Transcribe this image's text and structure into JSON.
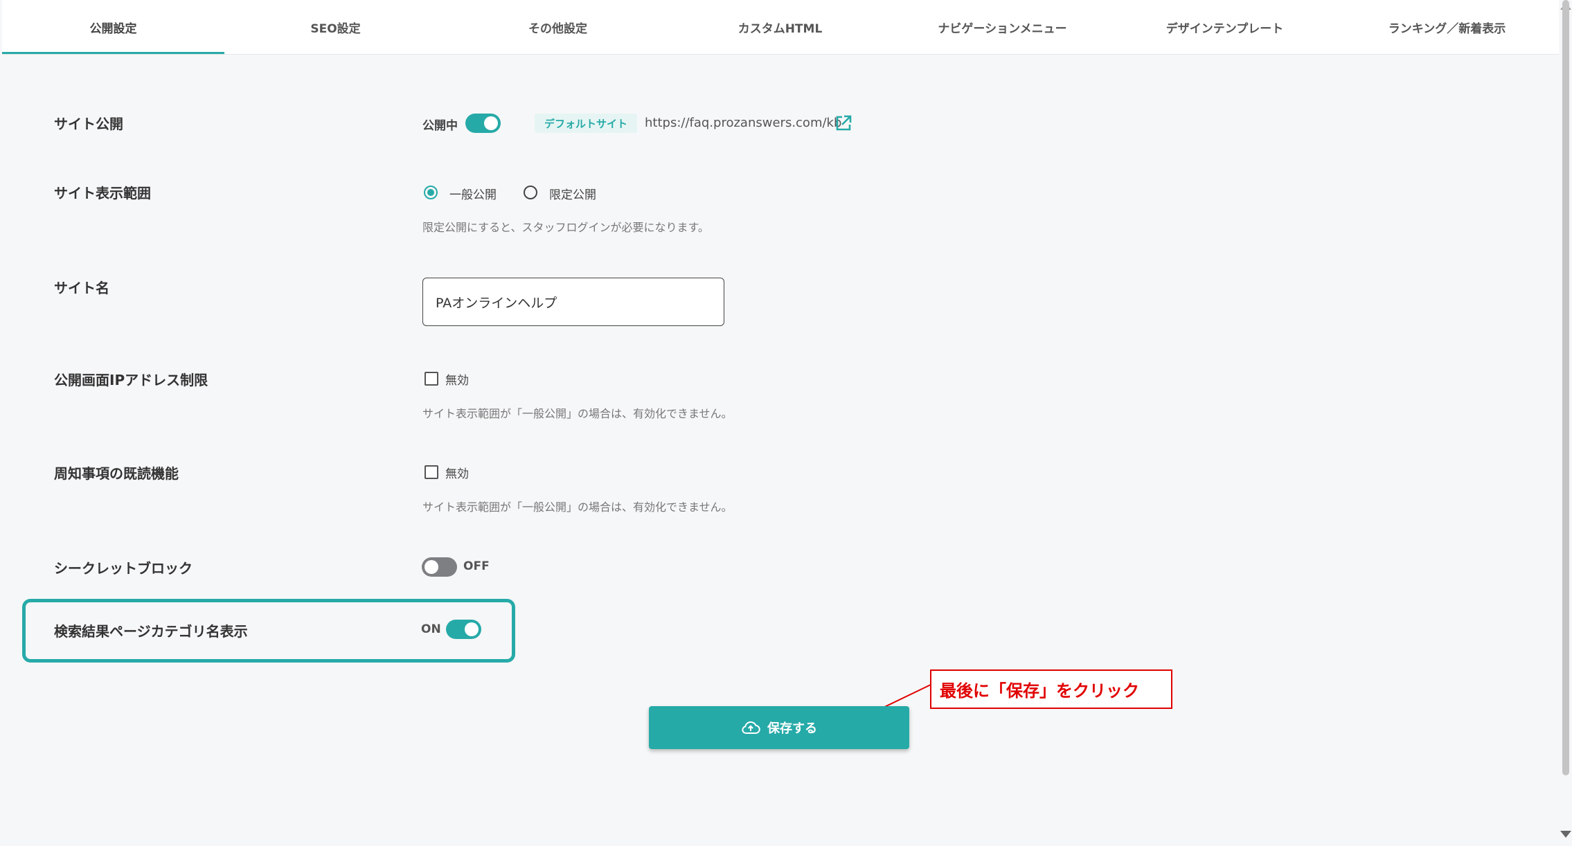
{
  "tabs": [
    {
      "label": "公開設定",
      "active": true
    },
    {
      "label": "SEO設定"
    },
    {
      "label": "その他設定"
    },
    {
      "label": "カスタムHTML"
    },
    {
      "label": "ナビゲーションメニュー"
    },
    {
      "label": "デザインテンプレート"
    },
    {
      "label": "ランキング／新着表示"
    }
  ],
  "site_public": {
    "label": "サイト公開",
    "status": "公開中",
    "toggle_on": true,
    "tag": "デフォルトサイト",
    "url": "https://faq.prozanswers.com/kb",
    "link_icon": "external-link-icon"
  },
  "site_scope": {
    "label": "サイト表示範囲",
    "options": [
      "一般公開",
      "限定公開"
    ],
    "selected": "一般公開",
    "help": "限定公開にすると、スタッフログインが必要になります。"
  },
  "site_name": {
    "label": "サイト名",
    "value": "PAオンラインヘルプ"
  },
  "ip_restriction": {
    "label": "公開画面IPアドレス制限",
    "checkbox_label": "無効",
    "checked": false,
    "help": "サイト表示範囲が「一般公開」の場合は、有効化できません。"
  },
  "read_feature": {
    "label": "周知事項の既読機能",
    "checkbox_label": "無効",
    "checked": false,
    "help": "サイト表示範囲が「一般公開」の場合は、有効化できません。"
  },
  "secret_block": {
    "label": "シークレットブロック",
    "state": "OFF",
    "toggle_on": false
  },
  "search_category": {
    "label": "検索結果ページカテゴリ名表示",
    "state": "ON",
    "toggle_on": true
  },
  "save_button": {
    "label": "保存する",
    "icon": "cloud-upload-icon"
  },
  "annotation": {
    "text": "最後に「保存」をクリック",
    "color": "#e10000"
  },
  "colors": {
    "accent": "#26aaa8",
    "toggle_off": "#7d7f83"
  }
}
